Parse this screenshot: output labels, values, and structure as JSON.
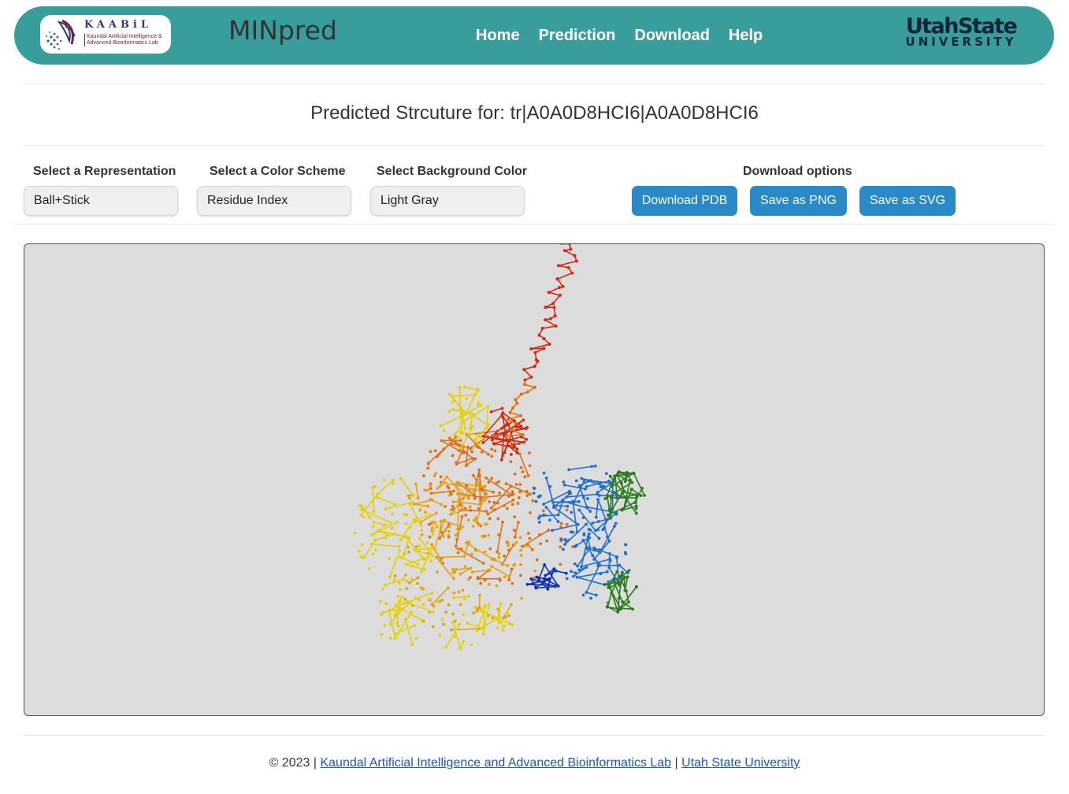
{
  "header": {
    "logo": {
      "title": "KAABiL",
      "subtitle": "Kaundal Artificial Intelligence & Advanced Bioinformatics Lab"
    },
    "brand": "MINpred",
    "nav": [
      "Home",
      "Prediction",
      "Download",
      "Help"
    ],
    "university": {
      "line1": "UtahState",
      "line2": "UNIVERSITY"
    }
  },
  "page": {
    "title": "Predicted Strcuture for: tr|A0A0D8HCI6|A0A0D8HCI6"
  },
  "controls": {
    "representation": {
      "label": "Select a Representation",
      "value": "Ball+Stick"
    },
    "color_scheme": {
      "label": "Select a Color Scheme",
      "value": "Residue Index"
    },
    "background": {
      "label": "Select Background Color",
      "value": "Light Gray"
    },
    "download": {
      "label": "Download options",
      "buttons": [
        "Download PDB",
        "Save as PNG",
        "Save as SVG"
      ]
    }
  },
  "viewer": {
    "background_color": "#dcdcdc",
    "scheme_colors": [
      "#0b2fb0",
      "#1f6fd0",
      "#2a7a1e",
      "#e8d000",
      "#e8a010",
      "#e07010",
      "#d02a10"
    ]
  },
  "footer": {
    "prefix": "© 2023 |",
    "link1": "Kaundal Artificial Intelligence and Advanced Bioinformatics Lab",
    "separator": "|",
    "link2": "Utah State University"
  },
  "colors": {
    "header_bg": "#399e9b",
    "button_bg": "#2a8ac8",
    "link": "#1a55c8"
  }
}
